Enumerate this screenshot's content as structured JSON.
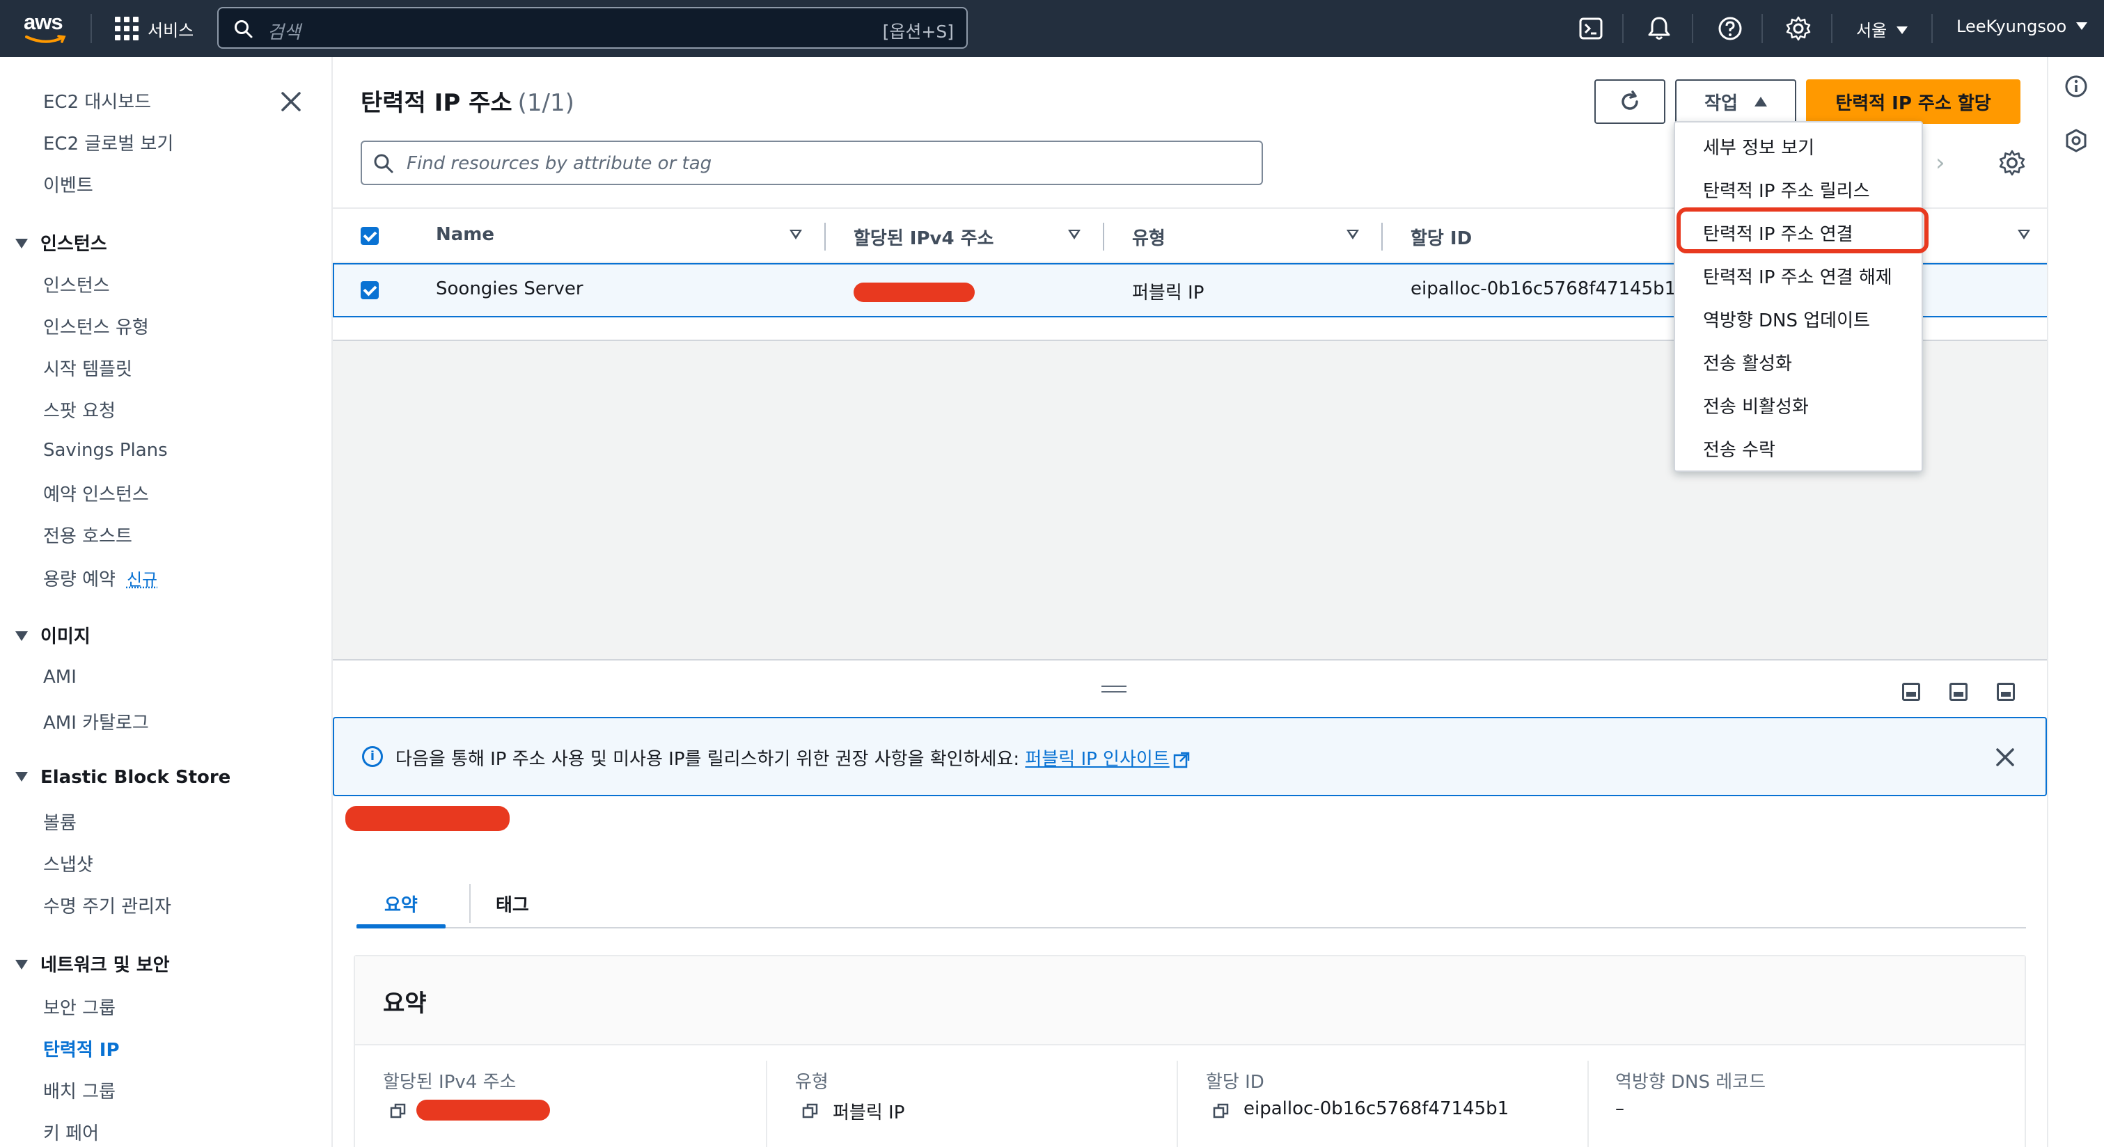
{
  "topnav": {
    "logo_text": "aws",
    "services_label": "서비스",
    "search_placeholder": "검색",
    "search_shortcut": "[옵션+S]",
    "region": "서울",
    "user": "LeeKyungsoo"
  },
  "sidebar": {
    "top_items": [
      "EC2 대시보드",
      "EC2 글로벌 보기",
      "이벤트"
    ],
    "sections": [
      {
        "title": "인스턴스",
        "items": [
          "인스턴스",
          "인스턴스 유형",
          "시작 템플릿",
          "스팟 요청",
          "Savings Plans",
          "예약 인스턴스",
          "전용 호스트",
          "용량 예약"
        ]
      },
      {
        "title": "이미지",
        "items": [
          "AMI",
          "AMI 카탈로그"
        ]
      },
      {
        "title": "Elastic Block Store",
        "items": [
          "볼륨",
          "스냅샷",
          "수명 주기 관리자"
        ]
      },
      {
        "title": "네트워크 및 보안",
        "items": [
          "보안 그룹",
          "탄력적 IP",
          "배치 그룹",
          "키 페어"
        ]
      }
    ],
    "new_badge": "신규",
    "active_item": "탄력적 IP"
  },
  "header": {
    "title": "탄력적 IP 주소",
    "count": "(1/1)",
    "actions_label": "작업",
    "allocate_label": "탄력적 IP 주소 할당",
    "filter_placeholder": "Find resources by attribute or tag"
  },
  "table": {
    "columns": [
      "Name",
      "할당된 IPv4 주소",
      "유형",
      "할당 ID"
    ],
    "rows": [
      {
        "name": "Soongies Server",
        "type": "퍼블릭 IP",
        "allocation_id": "eipalloc-0b16c5768f47145b1"
      }
    ]
  },
  "dropdown": {
    "items": [
      "세부 정보 보기",
      "탄력적 IP 주소 릴리스",
      "탄력적 IP 주소 연결",
      "탄력적 IP 주소 연결 해제",
      "역방향 DNS 업데이트",
      "전송 활성화",
      "전송 비활성화",
      "전송 수락"
    ],
    "highlighted": "탄력적 IP 주소 연결"
  },
  "banner": {
    "text": "다음을 통해 IP 주소 사용 및 미사용 IP를 릴리스하기 위한 권장 사항을 확인하세요: ",
    "link": "퍼블릭 IP 인사이트"
  },
  "details": {
    "tabs": [
      "요약",
      "태그"
    ],
    "summary_title": "요약",
    "fields": [
      {
        "label": "할당된 IPv4 주소",
        "value": ""
      },
      {
        "label": "유형",
        "value": "퍼블릭 IP"
      },
      {
        "label": "할당 ID",
        "value": "eipalloc-0b16c5768f47145b1"
      },
      {
        "label": "역방향 DNS 레코드",
        "value": "–"
      }
    ]
  },
  "colors": {
    "nav_bg": "#232f3e",
    "accent": "#0972d3",
    "primary_button": "#ff9900",
    "redaction": "#e8391f"
  }
}
